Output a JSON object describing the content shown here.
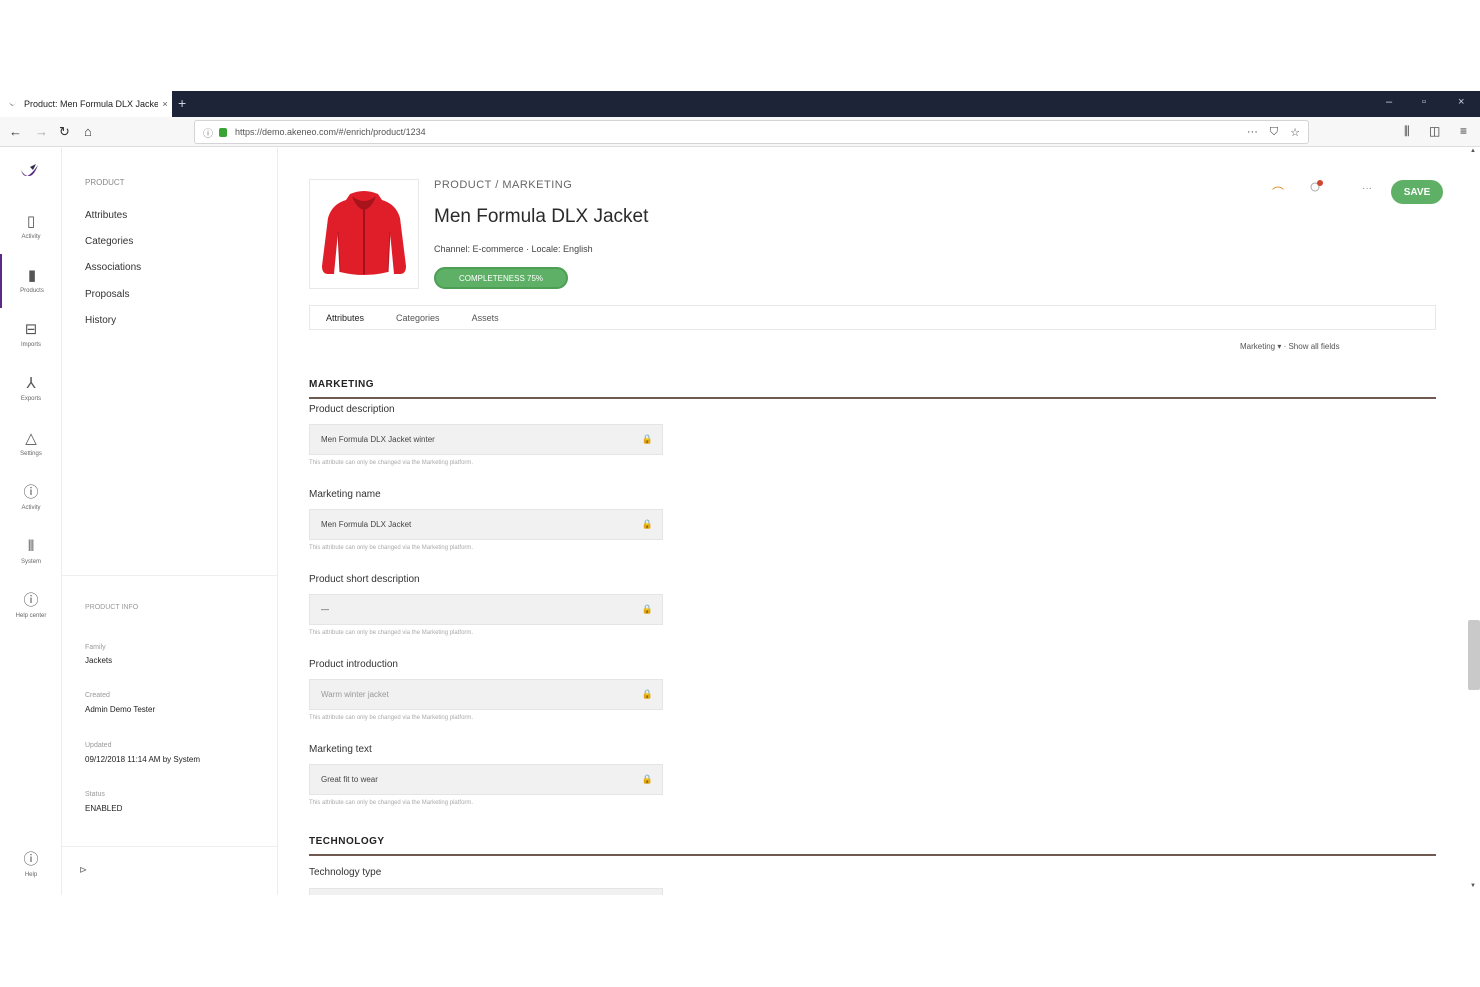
{
  "browser": {
    "tab_title": "Product: Men Formula DLX Jacket",
    "new_tab": "+",
    "url": "https://demo.akeneo.com/#/enrich/product/1234",
    "controls": {
      "minimize": "–",
      "maximize": "▫",
      "close": "×"
    }
  },
  "rail": {
    "items": [
      {
        "icon": "▯",
        "label": "Activity"
      },
      {
        "icon": "▮",
        "label": "Products",
        "active": true
      },
      {
        "icon": "⊟",
        "label": "Imports"
      },
      {
        "icon": "⅄",
        "label": "Exports"
      },
      {
        "icon": "△",
        "label": "Settings"
      },
      {
        "icon": "ⓘ",
        "label": "Activity"
      },
      {
        "icon": "⦀",
        "label": "System"
      },
      {
        "icon": "ⓘ",
        "label": "Help center"
      }
    ],
    "bottom": {
      "icon": "ⓘ",
      "label": "Help"
    }
  },
  "sidenav": {
    "header": "PRODUCT",
    "items": [
      "Attributes",
      "Categories",
      "Associations",
      "Proposals",
      "History"
    ],
    "meta_header": "PRODUCT INFO",
    "meta": [
      {
        "label": "Family",
        "value": "Jackets"
      },
      {
        "label": "Created",
        "value": "Admin Demo Tester"
      },
      {
        "label": "Updated",
        "value": "09/12/2018 11:14 AM by System"
      },
      {
        "label": "Status",
        "value": "ENABLED"
      }
    ],
    "collapse_icon": "⊳"
  },
  "product": {
    "kind": "PRODUCT / MARKETING",
    "title": "Men Formula DLX Jacket",
    "meta": "Channel: E-commerce · Locale: English",
    "completeness": "COMPLETENESS 75%",
    "save_label": "SAVE",
    "more": "···"
  },
  "tabs": [
    "Attributes",
    "Categories",
    "Assets"
  ],
  "group_switch": "Marketing ▾ · Show all fields",
  "sections": [
    {
      "title": "MARKETING",
      "fields": [
        {
          "label": "Product description",
          "value": "Men Formula DLX Jacket winter",
          "help": "This attribute can only be changed via the Marketing platform."
        },
        {
          "label": "Marketing name",
          "value": "Men Formula DLX Jacket",
          "help": "This attribute can only be changed via the Marketing platform."
        },
        {
          "label": "Product short description",
          "value": "—",
          "help": "This attribute can only be changed via the Marketing platform."
        },
        {
          "label": "Product introduction",
          "value": "Warm winter jacket",
          "help": "This attribute can only be changed via the Marketing platform."
        },
        {
          "label": "Marketing text",
          "value": "Great fit to wear",
          "help": "This attribute can only be changed via the Marketing platform."
        }
      ]
    },
    {
      "title": "TECHNOLOGY",
      "fields": [
        {
          "label": "Technology type",
          "value": "",
          "help": ""
        }
      ]
    }
  ],
  "colors": {
    "accent": "#5fb067",
    "brand": "#5b2a86",
    "section_line": "#6e5a50",
    "tabbar": "#1e2438",
    "jacket": "#e01e2a"
  }
}
